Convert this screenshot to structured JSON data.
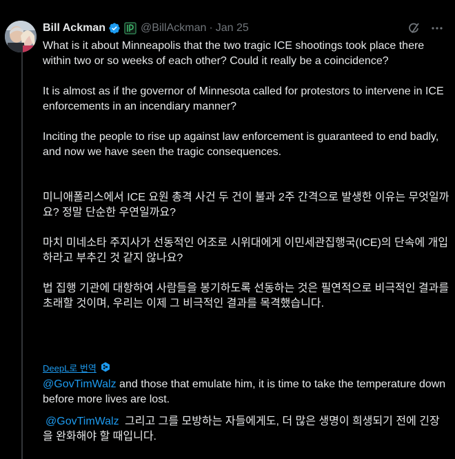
{
  "author": {
    "name": "Bill Ackman",
    "handle": "@BillAckman",
    "separator": "·",
    "date": "Jan 25"
  },
  "icons": {
    "verified": "verified-badge-icon",
    "affiliate": "affiliate-badge-icon",
    "grok": "grok-icon",
    "more": "more-options-icon",
    "deepl": "deepl-logo-icon"
  },
  "colors": {
    "background": "#000000",
    "text": "#e7e9ea",
    "muted": "#71767b",
    "accent": "#1d9bf0"
  },
  "post": {
    "paragraphs_en": [
      "What is it about Minneapolis that the two tragic ICE shootings took place there within two or so weeks of each other? Could it really be a coincidence?",
      "It is almost as if the governor of Minnesota called for protestors to intervene in ICE enforcements in an incendiary manner?",
      "Inciting the people to rise up against law enforcement is guaranteed to end badly, and now we have seen the tragic consequences."
    ],
    "paragraphs_ko": [
      "미니애폴리스에서 ICE 요원 총격 사건 두 건이 불과 2주 간격으로 발생한 이유는 무엇일까요? 정말 단순한 우연일까요?",
      "마치 미네소타 주지사가 선동적인 어조로 시위대에게 이민세관집행국(ICE)의 단속에 개입하라고 부추긴 것 같지 않나요?",
      "법 집행 기관에 대항하여 사람들을 봉기하도록 선동하는 것은 필연적으로 비극적인 결과를 초래할 것이며, 우리는 이제 그 비극적인 결과를 목격했습니다."
    ]
  },
  "translation": {
    "label": "DeepL로 번역"
  },
  "reply": {
    "mention": "@GovTimWalz",
    "text_en": " and those that emulate him, it is time to take the temperature down before more lives are lost.",
    "text_ko": " 그리고 그를 모방하는 자들에게도, 더 많은 생명이 희생되기 전에 긴장을 완화해야 할 때입니다."
  }
}
